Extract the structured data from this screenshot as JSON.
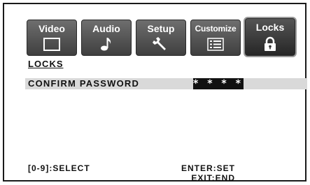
{
  "tabs": [
    {
      "label": "Video",
      "icon": "screen-icon"
    },
    {
      "label": "Audio",
      "icon": "music-note-icon"
    },
    {
      "label": "Setup",
      "icon": "wrench-icon"
    },
    {
      "label": "Customize",
      "icon": "list-icon"
    },
    {
      "label": "Locks",
      "icon": "padlock-icon",
      "active": true
    }
  ],
  "section": {
    "title": "LOCKS"
  },
  "password_row": {
    "label": "CONFIRM PASSWORD",
    "value": "* * * *"
  },
  "footer": {
    "select_hint": "[0-9]:SELECT",
    "set_hint": "ENTER:SET",
    "exit_hint": "EXIT:END"
  },
  "colors": {
    "tab_bg": "#4a4a4a",
    "row_highlight": "#d9d9d9",
    "password_bg": "#111111"
  }
}
